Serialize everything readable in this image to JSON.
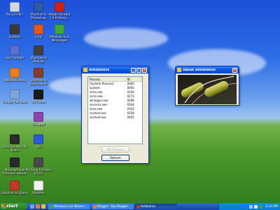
{
  "desktop": {
    "icons": [
      {
        "label": "Recycle Bin",
        "color": "#d0d8e0"
      },
      {
        "label": "Shortcut to Photoshop",
        "color": "#2a5aa8"
      },
      {
        "label": "Adobe Acrobat 7.0 Professi...",
        "color": "#c4261c"
      },
      {
        "label": "Audition",
        "color": "#3a3a3a"
      },
      {
        "label": "Vinyl",
        "color": "#e05a20"
      },
      {
        "label": "Windows Live Messenger",
        "color": "#3fa83c"
      },
      {
        "label": "Icon Tumbler",
        "color": "#5a6fd0"
      },
      {
        "label": "Shortcut to XenLab",
        "color": "#404040"
      },
      {
        "label": "Mozilla Firefox",
        "color": "#e67e22"
      },
      {
        "label": "Shortcut to Quicklaunch",
        "color": "#8a3d2a"
      },
      {
        "label": "Google Talk Beta",
        "color": "#7aa7d8"
      },
      {
        "label": "My Folder",
        "color": "#1a1a1a"
      },
      {
        "label": "Grouped",
        "color": "#8e44ad"
      },
      {
        "label": "Sony Ericsson PC Suite",
        "color": "#2c2c2c"
      },
      {
        "label": "ISO",
        "color": "#2a5ad8"
      },
      {
        "label": "Messagehead Premium details",
        "color": "#2a2a2a"
      },
      {
        "label": "My Sony Ericsson K510i",
        "color": "#4a4a4a"
      },
      {
        "label": "Shortcut to Opera",
        "color": "#c0392b"
      },
      {
        "label": "Readme",
        "color": "#f2f2f2"
      }
    ]
  },
  "antibiotics": {
    "title": "Antibiotics",
    "columns": [
      "Process",
      "ID"
    ],
    "rows": [
      {
        "process": "[System Process]",
        "id": "0000"
      },
      {
        "process": "System",
        "id": "0004"
      },
      {
        "process": "smss.exe",
        "id": "0240"
      },
      {
        "process": "csrss.exe",
        "id": "0273"
      },
      {
        "process": "winlogon.exe",
        "id": "0298"
      },
      {
        "process": "services.exe",
        "id": "0304"
      },
      {
        "process": "lsass.exe",
        "id": "0316"
      },
      {
        "process": "svchost.exe",
        "id": "0358"
      },
      {
        "process": "svchost.exe",
        "id": "0465"
      }
    ],
    "kill_label": "Kill Process",
    "refresh_label": "Refresh"
  },
  "about": {
    "title": "About Antibiotics"
  },
  "taskbar": {
    "start_label": "start",
    "tasks": [
      {
        "label": "Windows Live Messen...",
        "color": "#3fa83c"
      },
      {
        "label": "Blogger - Kay Blogger...",
        "color": "#e67e22"
      },
      {
        "label": "Antibiotics",
        "color": "#c0392b"
      }
    ],
    "clock": "3:14 PM"
  }
}
